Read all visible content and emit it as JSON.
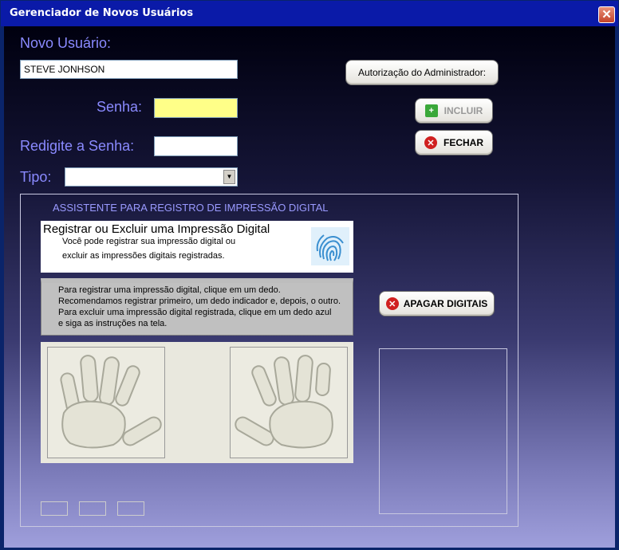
{
  "window": {
    "title": "Gerenciador de Novos Usuários",
    "close_label": "✕"
  },
  "form": {
    "novo_usuario_label": "Novo Usuário:",
    "novo_usuario_value": "STEVE JONHSON",
    "senha_label": "Senha:",
    "senha_value": "",
    "redigite_label": "Redigite a Senha:",
    "redigite_value": "",
    "tipo_label": "Tipo:",
    "tipo_value": ""
  },
  "buttons": {
    "autorizacao": "Autorização do Administrador:",
    "incluir": "INCLUIR",
    "fechar": "FECHAR",
    "apagar": "APAGAR DIGITAIS"
  },
  "assistant": {
    "heading": "ASSISTENTE PARA REGISTRO DE IMPRESSÃO DIGITAL",
    "help_title": "Registrar ou Excluir uma Impressão Digital",
    "help_line1": "Você pode registrar sua impressão digital ou",
    "help_line2": "excluir as impressões digitais registradas.",
    "instructions": [
      "Para registrar uma impressão digital, clique em um dedo.",
      "Recomendamos registrar primeiro, um dedo indicador e, depois, o outro.",
      "Para excluir uma impressão digital registrada, clique em um dedo azul",
      "e siga as instruções na tela."
    ]
  },
  "colors": {
    "label": "#8a8aff",
    "senha_bg": "#ffff88",
    "accent_green": "#3aa83a",
    "accent_red": "#d02020"
  }
}
